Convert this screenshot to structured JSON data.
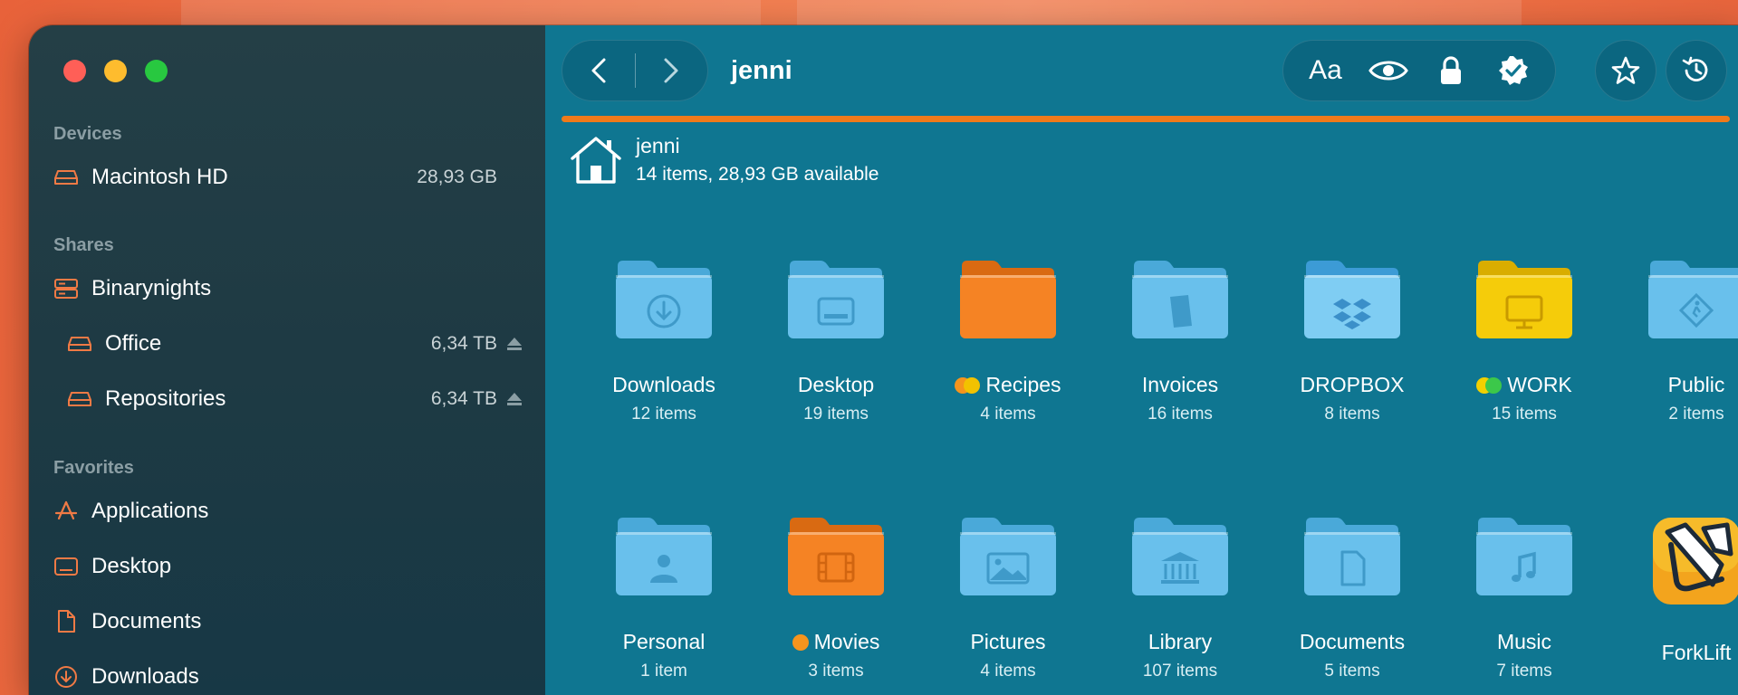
{
  "sidebar": {
    "sections": {
      "devices": "Devices",
      "shares": "Shares",
      "favorites": "Favorites"
    },
    "devices": [
      {
        "label": "Macintosh HD",
        "size": "28,93 GB",
        "icon": "drive-icon"
      }
    ],
    "shares": [
      {
        "label": "Binarynights",
        "icon": "server-icon"
      },
      {
        "label": "Office",
        "size": "6,34 TB",
        "icon": "drive-icon"
      },
      {
        "label": "Repositories",
        "size": "6,34 TB",
        "icon": "drive-icon"
      }
    ],
    "favorites": [
      {
        "label": "Applications",
        "icon": "applications-icon"
      },
      {
        "label": "Desktop",
        "icon": "desktop-icon"
      },
      {
        "label": "Documents",
        "icon": "document-icon"
      },
      {
        "label": "Downloads",
        "icon": "download-icon"
      }
    ]
  },
  "toolbar": {
    "path_title": "jenni",
    "font_label": "Aa"
  },
  "header": {
    "name": "jenni",
    "meta": "14 items, 28,93 GB available"
  },
  "colors": {
    "accent": "#ef7a1a",
    "main_bg": "#0f7691",
    "folder_blue": "#5bb8e6",
    "folder_orange": "#f07d1e",
    "folder_yellow": "#f2c200"
  },
  "items": [
    {
      "name": "Downloads",
      "count": "12 items",
      "type": "blue",
      "glyph": "download",
      "tags": []
    },
    {
      "name": "Desktop",
      "count": "19 items",
      "type": "blue",
      "glyph": "desktop",
      "tags": []
    },
    {
      "name": "Recipes",
      "count": "4 items",
      "type": "orange",
      "glyph": "none",
      "tags": [
        "#f5941d",
        "#f2c200"
      ]
    },
    {
      "name": "Invoices",
      "count": "16 items",
      "type": "blue",
      "glyph": "doc",
      "tags": []
    },
    {
      "name": "DROPBOX",
      "count": "8 items",
      "type": "lightblue",
      "glyph": "dropbox",
      "tags": []
    },
    {
      "name": "WORK",
      "count": "15 items",
      "type": "yellow",
      "glyph": "monitor",
      "tags": [
        "#f2d000",
        "#3cc84a"
      ]
    },
    {
      "name": "Public",
      "count": "2 items",
      "type": "blue",
      "glyph": "walk",
      "tags": []
    },
    {
      "name": "Personal",
      "count": "1 item",
      "type": "blue",
      "glyph": "person",
      "tags": []
    },
    {
      "name": "Movies",
      "count": "3 items",
      "type": "orange",
      "glyph": "film",
      "tags": [
        "#f5941d"
      ]
    },
    {
      "name": "Pictures",
      "count": "4 items",
      "type": "blue",
      "glyph": "picture",
      "tags": []
    },
    {
      "name": "Library",
      "count": "107 items",
      "type": "blue",
      "glyph": "bank",
      "tags": []
    },
    {
      "name": "Documents",
      "count": "5 items",
      "type": "blue",
      "glyph": "page",
      "tags": []
    },
    {
      "name": "Music",
      "count": "7 items",
      "type": "blue",
      "glyph": "music",
      "tags": []
    },
    {
      "name": "ForkLift",
      "count": "",
      "type": "app",
      "glyph": "forklift",
      "tags": []
    }
  ]
}
